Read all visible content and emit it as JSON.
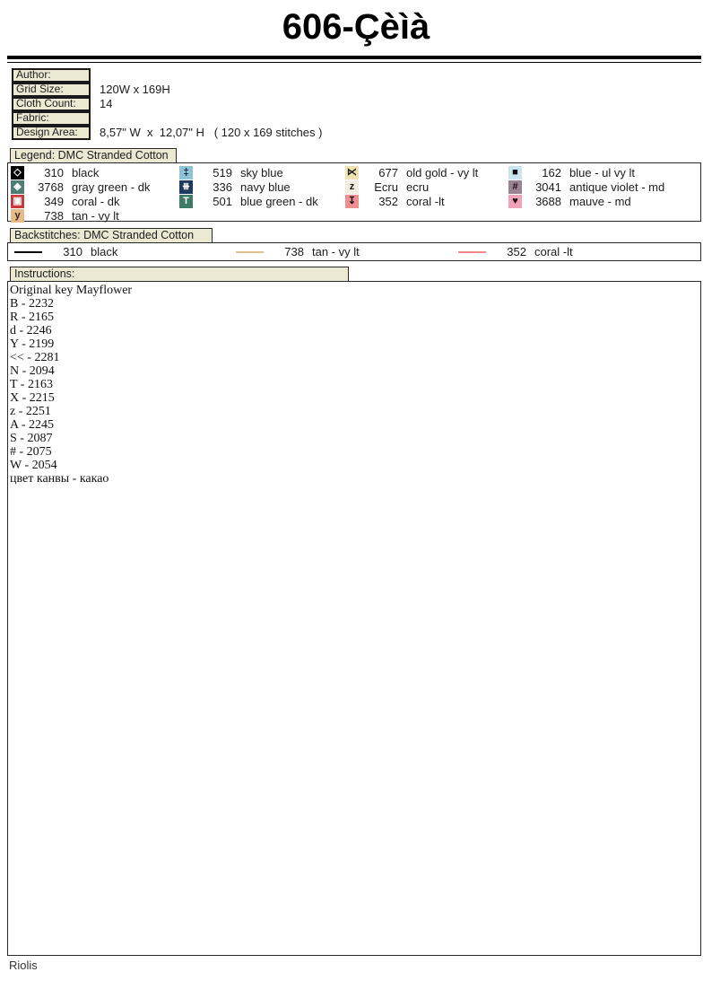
{
  "page": {
    "title": "606-Çèìà",
    "footer": "Riolis"
  },
  "info": {
    "rows": [
      {
        "label": "Author:",
        "value": ""
      },
      {
        "label": "Grid Size:",
        "value": "120W x 169H"
      },
      {
        "label": "Cloth Count:",
        "value": "14"
      },
      {
        "label": "Fabric:",
        "value": ""
      },
      {
        "label": "Design Area:",
        "value": "8,57\" W  x  12,07\" H   ( 120 x 169 stitches )"
      }
    ]
  },
  "legend": {
    "header": "Legend: DMC Stranded Cotton",
    "entries": [
      {
        "symbol": "◇",
        "number": "310",
        "name": "black",
        "bg": "#000000",
        "fg": "#ffffff"
      },
      {
        "symbol": "◈",
        "number": "3768",
        "name": "gray green - dk",
        "bg": "#4f7d74",
        "fg": "#ffffff"
      },
      {
        "symbol": "▣",
        "number": "349",
        "name": "coral - dk",
        "bg": "#c93a3c",
        "fg": "#ffffff"
      },
      {
        "symbol": "y",
        "number": "738",
        "name": "tan - vy lt",
        "bg": "#e2ba8c",
        "fg": "#3a2414"
      },
      {
        "symbol": "‡",
        "number": "519",
        "name": "sky blue",
        "bg": "#8ec2d6",
        "fg": "#0a2030"
      },
      {
        "symbol": "⧻",
        "number": "336",
        "name": "navy blue",
        "bg": "#1e3a60",
        "fg": "#ffffff"
      },
      {
        "symbol": "T",
        "number": "501",
        "name": "blue green - dk",
        "bg": "#3d7a68",
        "fg": "#ffffff"
      },
      {
        "symbol": "⋉",
        "number": "677",
        "name": "old gold - vy lt",
        "bg": "#efe3b2",
        "fg": "#1c1c1c"
      },
      {
        "symbol": "z",
        "number": "Ecru",
        "name": "ecru",
        "bg": "#f2ede0",
        "fg": "#1c1c1c"
      },
      {
        "symbol": "↧",
        "number": "352",
        "name": "coral -lt",
        "bg": "#ec8f8f",
        "fg": "#1c0e0e"
      },
      {
        "symbol": "■",
        "number": "162",
        "name": "blue - ul vy lt",
        "bg": "#cbe4f0",
        "fg": "#0c0c0c"
      },
      {
        "symbol": "#",
        "number": "3041",
        "name": "antique violet - md",
        "bg": "#9b8391",
        "fg": "#1c101c"
      },
      {
        "symbol": "♥",
        "number": "3688",
        "name": "mauve - md",
        "bg": "#f0a3b8",
        "fg": "#1c0e12"
      }
    ]
  },
  "backstitches": {
    "header": "Backstitches: DMC Stranded Cotton",
    "entries": [
      {
        "number": "310",
        "name": "black",
        "color": "#000000"
      },
      {
        "number": "738",
        "name": "tan - vy lt",
        "color": "#e0c08e"
      },
      {
        "number": "352",
        "name": "coral -lt",
        "color": "#f08a8a"
      }
    ]
  },
  "instructions": {
    "header": "Instructions:",
    "lines": [
      "Original key Mayflower",
      "B - 2232",
      "R - 2165",
      "d - 2246",
      "Y - 2199",
      "<< - 2281",
      "N - 2094",
      "T - 2163",
      "X - 2215",
      "z - 2251",
      "A - 2245",
      "S - 2087",
      "# - 2075",
      "W - 2054",
      "цвет канвы - какао"
    ]
  }
}
